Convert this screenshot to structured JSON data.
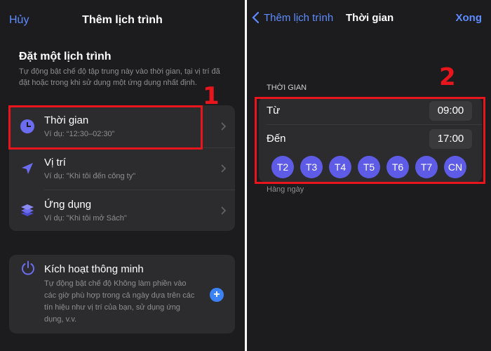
{
  "left": {
    "nav": {
      "cancel": "Hủy",
      "title": "Thêm lịch trình"
    },
    "section": {
      "title": "Đặt một lịch trình",
      "description": "Tự động bật chế độ tập trung này vào thời gian, tại vị trí đã đặt hoặc trong khi sử dụng một ứng dụng nhất định."
    },
    "options": [
      {
        "icon": "clock-icon",
        "title": "Thời gian",
        "subtitle": "Ví dụ: “12:30–02:30”"
      },
      {
        "icon": "location-arrow-icon",
        "title": "Vị trí",
        "subtitle": "Ví dụ: \"Khi tôi đến công ty\""
      },
      {
        "icon": "app-stack-icon",
        "title": "Ứng dụng",
        "subtitle": "Ví dụ: \"Khi tôi mở Sách\""
      }
    ],
    "smart": {
      "icon": "power-icon",
      "title": "Kích hoạt thông minh",
      "description": "Tự động bật chế độ Không làm phiền vào các giờ phù hợp trong cả ngày dựa trên các tín hiệu như vị trí của bạn, sử dụng ứng dụng, v.v.",
      "add_label": "+"
    },
    "annotation": "1"
  },
  "right": {
    "nav": {
      "back": "Thêm lịch trình",
      "title": "Thời gian",
      "done": "Xong"
    },
    "section_header": "THỜI GIAN",
    "from": {
      "label": "Từ",
      "value": "09:00"
    },
    "to": {
      "label": "Đến",
      "value": "17:00"
    },
    "days": [
      "T2",
      "T3",
      "T4",
      "T5",
      "T6",
      "T7",
      "CN"
    ],
    "repeat_note": "Hàng ngày",
    "annotation": "2"
  },
  "colors": {
    "background": "#1c1c1e",
    "card": "#2c2c2e",
    "accent_blue": "#5e8cff",
    "day_purple": "#5e5ce6",
    "highlight_red": "#e8161c"
  }
}
